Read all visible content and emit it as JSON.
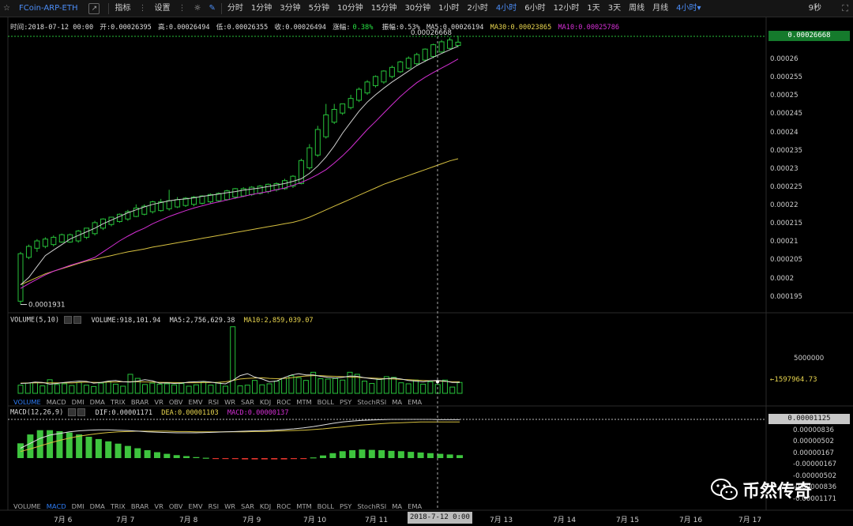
{
  "toolbar": {
    "symbol": "FCoin-ARP-ETH",
    "indicator_label": "指标",
    "settings_label": "设置",
    "periods": [
      "分时",
      "1分钟",
      "3分钟",
      "5分钟",
      "10分钟",
      "15分钟",
      "30分钟",
      "1小时",
      "2小时",
      "4小时",
      "6小时",
      "12小时",
      "1天",
      "3天",
      "周线",
      "月线"
    ],
    "active_period": "4小时",
    "dropdown_label": "4小时",
    "countdown": "9秒"
  },
  "info": {
    "time_label": "时间:2018-07-12 00:00",
    "open_label": "开:0.00026395",
    "high_label": "高:0.00026494",
    "low_label": "低:0.00026355",
    "close_label": "收:0.00026494",
    "change_prefix": "涨幅:",
    "change_value": "0.38%",
    "amplitude_label": "振幅:0.53%",
    "ma5_label": "MA5:0.00026194",
    "ma30_label": "MA30:0.00023865",
    "ma10_label": "MA10:0.00025786"
  },
  "volume_panel": {
    "title": "VOLUME(5,10)",
    "volume_label": "VOLUME:918,101.94",
    "ma5_label": "MA5:2,756,629.38",
    "ma10_label": "MA10:2,859,039.07",
    "tag": "←1597964.73"
  },
  "macd_panel": {
    "title": "MACD(12,26,9)",
    "dif_label": "DIF:0.00001171",
    "dea_label": "DEA:0.00001103",
    "macd_label": "MACD:0.00000137"
  },
  "tabs": [
    "VOLUME",
    "MACD",
    "DMI",
    "DMA",
    "TRIX",
    "BRAR",
    "VR",
    "OBV",
    "EMV",
    "RSI",
    "WR",
    "SAR",
    "KDJ",
    "ROC",
    "MTM",
    "BOLL",
    "PSY",
    "StochRSI",
    "MA",
    "EMA"
  ],
  "tabs_active_row1": "VOLUME",
  "tabs_active_row2": "MACD",
  "price_tag": "0.00026668",
  "macd_tag": "0.00001125",
  "cursor_date": "2018-7-12 0:00",
  "watermark": "币然传奇",
  "colors": {
    "up": "#27c23a",
    "down": "#e0342c",
    "ma5": "#cfcfcf",
    "ma10": "#d42fd4",
    "ma30": "#d6c040",
    "accent": "#4c8df6"
  },
  "chart_data": [
    {
      "type": "candlestick",
      "ylim": [
        0.000193,
        0.0002665
      ],
      "yticks": [
        "0.00026668",
        "0.00026",
        "0.000255",
        "0.00025",
        "0.000245",
        "0.00024",
        "0.000235",
        "0.00023",
        "0.000225",
        "0.00022",
        "0.000215",
        "0.00021",
        "0.000205",
        "0.0002",
        "0.000195"
      ],
      "annotations": {
        "high": "0.00026668",
        "low": "0.0001931"
      },
      "candles": [
        {
          "o": 0.000194,
          "h": 0.0002075,
          "l": 0.0001931,
          "c": 0.000207
        },
        {
          "o": 0.000206,
          "h": 0.0002095,
          "l": 0.0002055,
          "c": 0.000209
        },
        {
          "o": 0.0002085,
          "h": 0.000211,
          "l": 0.0002075,
          "c": 0.0002105
        },
        {
          "o": 0.000209,
          "h": 0.0002115,
          "l": 0.0002085,
          "c": 0.000211
        },
        {
          "o": 0.0002095,
          "h": 0.000212,
          "l": 0.000209,
          "c": 0.0002115
        },
        {
          "o": 0.0002102,
          "h": 0.0002125,
          "l": 0.00021,
          "c": 0.0002122
        },
        {
          "o": 0.0002102,
          "h": 0.0002125,
          "l": 0.00021,
          "c": 0.0002122
        },
        {
          "o": 0.0002105,
          "h": 0.0002135,
          "l": 0.00021,
          "c": 0.0002132
        },
        {
          "o": 0.0002115,
          "h": 0.000214,
          "l": 0.000211,
          "c": 0.000214
        },
        {
          "o": 0.0002125,
          "h": 0.000216,
          "l": 0.000212,
          "c": 0.0002155
        },
        {
          "o": 0.000214,
          "h": 0.0002167,
          "l": 0.0002135,
          "c": 0.0002165
        },
        {
          "o": 0.000215,
          "h": 0.000217,
          "l": 0.0002145,
          "c": 0.000217
        },
        {
          "o": 0.0002158,
          "h": 0.000218,
          "l": 0.0002155,
          "c": 0.0002178
        },
        {
          "o": 0.0002165,
          "h": 0.000219,
          "l": 0.000216,
          "c": 0.0002185
        },
        {
          "o": 0.0002172,
          "h": 0.0002205,
          "l": 0.000217,
          "c": 0.0002195
        },
        {
          "o": 0.0002178,
          "h": 0.0002205,
          "l": 0.0002175,
          "c": 0.00022
        },
        {
          "o": 0.0002185,
          "h": 0.0002215,
          "l": 0.000218,
          "c": 0.0002212
        },
        {
          "o": 0.0002188,
          "h": 0.000222,
          "l": 0.0002185,
          "c": 0.0002212
        },
        {
          "o": 0.0002193,
          "h": 0.0002245,
          "l": 0.0002188,
          "c": 0.0002215
        },
        {
          "o": 0.0002198,
          "h": 0.0002225,
          "l": 0.0002195,
          "c": 0.0002218
        },
        {
          "o": 0.0002202,
          "h": 0.0002225,
          "l": 0.0002198,
          "c": 0.0002222
        },
        {
          "o": 0.0002205,
          "h": 0.0002228,
          "l": 0.00022,
          "c": 0.0002225
        },
        {
          "o": 0.0002208,
          "h": 0.000223,
          "l": 0.0002205,
          "c": 0.0002228
        },
        {
          "o": 0.0002212,
          "h": 0.0002235,
          "l": 0.0002208,
          "c": 0.0002232
        },
        {
          "o": 0.0002215,
          "h": 0.0002238,
          "l": 0.0002212,
          "c": 0.0002235
        },
        {
          "o": 0.0002218,
          "h": 0.0002245,
          "l": 0.0002215,
          "c": 0.0002242
        },
        {
          "o": 0.0002225,
          "h": 0.000225,
          "l": 0.000222,
          "c": 0.0002248
        },
        {
          "o": 0.0002228,
          "h": 0.0002252,
          "l": 0.0002225,
          "c": 0.0002248
        },
        {
          "o": 0.0002232,
          "h": 0.0002255,
          "l": 0.0002228,
          "c": 0.0002252
        },
        {
          "o": 0.0002235,
          "h": 0.0002258,
          "l": 0.0002232,
          "c": 0.0002255
        },
        {
          "o": 0.000224,
          "h": 0.0002262,
          "l": 0.0002235,
          "c": 0.000226
        },
        {
          "o": 0.0002245,
          "h": 0.0002265,
          "l": 0.000224,
          "c": 0.0002262
        },
        {
          "o": 0.0002248,
          "h": 0.0002275,
          "l": 0.0002245,
          "c": 0.000227
        },
        {
          "o": 0.0002255,
          "h": 0.0002285,
          "l": 0.000225,
          "c": 0.0002282
        },
        {
          "o": 0.0002262,
          "h": 0.000233,
          "l": 0.000226,
          "c": 0.0002325
        },
        {
          "o": 0.0002305,
          "h": 0.000237,
          "l": 0.00023,
          "c": 0.000236
        },
        {
          "o": 0.000234,
          "h": 0.000242,
          "l": 0.0002335,
          "c": 0.000241
        },
        {
          "o": 0.000239,
          "h": 0.000248,
          "l": 0.0002385,
          "c": 0.000245
        },
        {
          "o": 0.000243,
          "h": 0.000248,
          "l": 0.0002425,
          "c": 0.0002465
        },
        {
          "o": 0.0002455,
          "h": 0.000248,
          "l": 0.000245,
          "c": 0.000248
        },
        {
          "o": 0.000247,
          "h": 0.0002505,
          "l": 0.0002465,
          "c": 0.0002495
        },
        {
          "o": 0.000249,
          "h": 0.0002525,
          "l": 0.0002485,
          "c": 0.000252
        },
        {
          "o": 0.000251,
          "h": 0.0002545,
          "l": 0.0002505,
          "c": 0.000254
        },
        {
          "o": 0.000253,
          "h": 0.0002558,
          "l": 0.0002525,
          "c": 0.0002555
        },
        {
          "o": 0.000254,
          "h": 0.0002572,
          "l": 0.0002535,
          "c": 0.000257
        },
        {
          "o": 0.0002555,
          "h": 0.0002585,
          "l": 0.000255,
          "c": 0.000258
        },
        {
          "o": 0.0002568,
          "h": 0.0002598,
          "l": 0.0002565,
          "c": 0.0002595
        },
        {
          "o": 0.0002578,
          "h": 0.000261,
          "l": 0.0002575,
          "c": 0.0002605
        },
        {
          "o": 0.000259,
          "h": 0.000262,
          "l": 0.0002585,
          "c": 0.0002615
        },
        {
          "o": 0.00026,
          "h": 0.0002632,
          "l": 0.0002595,
          "c": 0.000263
        },
        {
          "o": 0.000261,
          "h": 0.0002645,
          "l": 0.0002605,
          "c": 0.0002642
        },
        {
          "o": 0.0002622,
          "h": 0.0002655,
          "l": 0.000262,
          "c": 0.000265
        },
        {
          "o": 0.0002632,
          "h": 0.0002662,
          "l": 0.000263,
          "c": 0.0002655
        },
        {
          "o": 0.000264,
          "h": 0.0002667,
          "l": 0.0002635,
          "c": 0.0002649
        }
      ],
      "ma5": [
        0.0001985,
        0.0002005,
        0.0002035,
        0.0002065,
        0.000208,
        0.0002095,
        0.000211,
        0.000212,
        0.000213,
        0.000214,
        0.0002152,
        0.0002162,
        0.0002172,
        0.0002182,
        0.000219,
        0.0002198,
        0.0002205,
        0.000221,
        0.0002215,
        0.0002218,
        0.000222,
        0.0002223,
        0.0002227,
        0.000223,
        0.0002233,
        0.0002237,
        0.000224,
        0.0002244,
        0.0002247,
        0.000225,
        0.0002254,
        0.0002258,
        0.0002262,
        0.0002268,
        0.0002275,
        0.000229,
        0.000231,
        0.0002335,
        0.0002365,
        0.00024,
        0.000243,
        0.000246,
        0.0002485,
        0.0002505,
        0.0002523,
        0.000254,
        0.0002555,
        0.000257,
        0.0002585,
        0.0002597,
        0.0002608,
        0.0002618,
        0.0002628,
        0.0002638
      ],
      "ma10": [
        0.0001975,
        0.0001988,
        0.0002,
        0.0002012,
        0.0002022,
        0.000203,
        0.0002038,
        0.0002045,
        0.0002052,
        0.000206,
        0.0002075,
        0.000209,
        0.0002105,
        0.0002118,
        0.000213,
        0.000214,
        0.0002152,
        0.0002162,
        0.0002172,
        0.000218,
        0.0002188,
        0.0002195,
        0.0002201,
        0.0002207,
        0.0002212,
        0.0002217,
        0.0002222,
        0.0002227,
        0.0002232,
        0.0002236,
        0.000224,
        0.0002245,
        0.000225,
        0.0002257,
        0.0002265,
        0.0002275,
        0.0002287,
        0.00023,
        0.0002318,
        0.0002338,
        0.000236,
        0.0002385,
        0.000241,
        0.0002432,
        0.0002455,
        0.0002478,
        0.00025,
        0.000252,
        0.0002538,
        0.0002553,
        0.0002566,
        0.0002578,
        0.000259,
        0.0002603
      ],
      "ma30": [
        0.0001985,
        0.0001995,
        0.0002005,
        0.0002015,
        0.0002022,
        0.0002029,
        0.0002036,
        0.0002043,
        0.000205,
        0.0002055,
        0.000206,
        0.0002065,
        0.000207,
        0.0002075,
        0.0002079,
        0.0002083,
        0.0002088,
        0.0002092,
        0.0002096,
        0.00021,
        0.0002104,
        0.0002108,
        0.0002112,
        0.0002116,
        0.000212,
        0.0002124,
        0.0002128,
        0.0002132,
        0.0002136,
        0.000214,
        0.0002144,
        0.0002148,
        0.0002152,
        0.0002156,
        0.0002162,
        0.000217,
        0.000218,
        0.000219,
        0.00022,
        0.000221,
        0.000222,
        0.000223,
        0.000224,
        0.000225,
        0.000226,
        0.0002268,
        0.0002276,
        0.0002284,
        0.0002292,
        0.00023,
        0.0002308,
        0.0002316,
        0.0002324,
        0.000233
      ]
    },
    {
      "type": "bar",
      "name": "VOLUME",
      "ylim": [
        0,
        10000000
      ],
      "ytick": "5000000",
      "values": [
        1200000,
        1500000,
        1600000,
        1100000,
        2000000,
        1300000,
        1400000,
        1150000,
        1600000,
        1200000,
        1000000,
        1500000,
        1700000,
        1350000,
        1050000,
        2800000,
        2200000,
        1300000,
        1500000,
        1350000,
        1400000,
        1250000,
        1450000,
        1050000,
        1250000,
        1700000,
        1200000,
        1600000,
        1050000,
        9800000,
        1100000,
        1200000,
        1900000,
        1250000,
        1400000,
        1800000,
        2200000,
        2600000,
        2300000,
        1900000,
        3100000,
        2150000,
        2100000,
        2200000,
        1950000,
        3100000,
        2800000,
        1800000,
        1450000,
        2050000,
        2450000,
        2350000,
        1550000,
        1400000,
        1950000,
        1350000,
        1700000,
        1300000,
        1950000,
        920000,
        1600000
      ],
      "ma5": [
        1450000,
        1500000,
        1650000,
        1600000,
        1350000,
        1450000,
        1600000,
        1700000,
        1800000,
        1750000,
        1500000,
        1600000,
        1800000,
        1900000,
        1700000,
        1650000,
        1800000,
        2000000,
        1850000,
        1500000,
        1550000,
        1450000,
        1500000,
        1650000,
        1700000,
        1750000,
        1650000,
        1500000,
        1400000,
        1900000,
        2600000,
        2900000,
        2400000,
        2100000,
        1700000,
        1800000,
        2300000,
        2700000,
        2900000,
        2700000,
        2700000,
        2500000,
        2350000,
        2250000,
        2350000,
        2550000,
        2500000,
        2300000,
        2150000,
        2050000,
        2150000,
        2250000,
        2100000,
        1900000,
        1800000,
        1700000,
        1850000,
        1900000,
        1800000,
        1600000,
        1600000
      ],
      "ma10": [
        1500000,
        1520000,
        1540000,
        1560000,
        1550000,
        1540000,
        1530000,
        1520000,
        1600000,
        1650000,
        1620000,
        1600000,
        1650000,
        1680000,
        1700000,
        1720000,
        1700000,
        1680000,
        1650000,
        1620000,
        1600000,
        1580000,
        1570000,
        1560000,
        1560000,
        1580000,
        1600000,
        1620000,
        1700000,
        1900000,
        2100000,
        2200000,
        2250000,
        2300000,
        2200000,
        2150000,
        2200000,
        2300000,
        2450000,
        2550000,
        2600000,
        2600000,
        2550000,
        2500000,
        2450000,
        2400000,
        2350000,
        2300000,
        2250000,
        2200000,
        2150000,
        2100000,
        2050000,
        2000000,
        1950000,
        1900000,
        1850000,
        1800000,
        1750000,
        1700000,
        1700000
      ]
    },
    {
      "type": "bar",
      "name": "MACD",
      "ylim": [
        -1.4e-06,
        1.2e-06
      ],
      "yticks": [
        "0.00001125",
        "0.00000836",
        "0.00000502",
        "0.00000167",
        "-0.00000167",
        "-0.00000502",
        "-0.00000836",
        "-0.00001171"
      ],
      "hist": [
        4.5e-06,
        7.2e-06,
        8.5e-06,
        8.5e-06,
        8.2e-06,
        7.8e-06,
        7.2e-06,
        6.5e-06,
        5.8e-06,
        5.1e-06,
        4.4e-06,
        3.7e-06,
        3e-06,
        2.4e-06,
        1.8e-06,
        1.3e-06,
        9e-07,
        6e-07,
        3e-07,
        1e-07,
        -1e-07,
        -2e-07,
        -3e-07,
        -4e-07,
        -4e-07,
        -4e-07,
        -4e-07,
        -4e-07,
        -3e-07,
        -2e-07,
        2e-07,
        8e-07,
        1.5e-06,
        2.1e-06,
        2.4e-06,
        2.6e-06,
        2.5e-06,
        2.4e-06,
        2.2e-06,
        2.1e-06,
        1.9e-06,
        1.7e-06,
        1.5e-06,
        1.3e-06,
        1.1e-06,
        9e-07
      ],
      "dif": [
        3e-06,
        4.5e-06,
        6e-06,
        7e-06,
        7.5e-06,
        8e-06,
        8.3e-06,
        8.5e-06,
        8.6e-06,
        8.6e-06,
        8.5e-06,
        8.4e-06,
        8.2e-06,
        8e-06,
        7.9e-06,
        7.8e-06,
        7.7e-06,
        7.7e-06,
        7.7e-06,
        7.8e-06,
        7.9e-06,
        8e-06,
        8.1e-06,
        8.2e-06,
        8.3e-06,
        8.4e-06,
        8.5e-06,
        8.7e-06,
        8.9e-06,
        9.2e-06,
        9.6e-06,
        1.01e-05,
        1.06e-05,
        1.1e-05,
        1.13e-05,
        1.15e-05,
        1.16e-05,
        1.17e-05,
        1.18e-05,
        1.18e-05,
        1.18e-05,
        1.18e-05,
        1.18e-05,
        1.17e-05,
        1.17e-05,
        1.17e-05
      ],
      "dea": [
        2e-06,
        2.8e-06,
        3.7e-06,
        4.6e-06,
        5.4e-06,
        6.1e-06,
        6.7e-06,
        7.1e-06,
        7.5e-06,
        7.8e-06,
        8e-06,
        8.1e-06,
        8.2e-06,
        8.2e-06,
        8.2e-06,
        8.2e-06,
        8.1e-06,
        8.1e-06,
        8e-06,
        8e-06,
        8e-06,
        8e-06,
        8e-06,
        8e-06,
        8.1e-06,
        8.1e-06,
        8.2e-06,
        8.3e-06,
        8.4e-06,
        8.5e-06,
        8.7e-06,
        8.9e-06,
        9.2e-06,
        9.5e-06,
        9.8e-06,
        1.01e-05,
        1.03e-05,
        1.05e-05,
        1.07e-05,
        1.08e-05,
        1.09e-05,
        1.1e-05,
        1.1e-05,
        1.1e-05,
        1.1e-05,
        1.1e-05
      ]
    }
  ],
  "x_labels": [
    "7月 6",
    "7月 7",
    "7月 8",
    "7月 9",
    "7月 10",
    "7月 11",
    "7月 13",
    "7月 14",
    "7月 15",
    "7月 16",
    "7月 17"
  ]
}
